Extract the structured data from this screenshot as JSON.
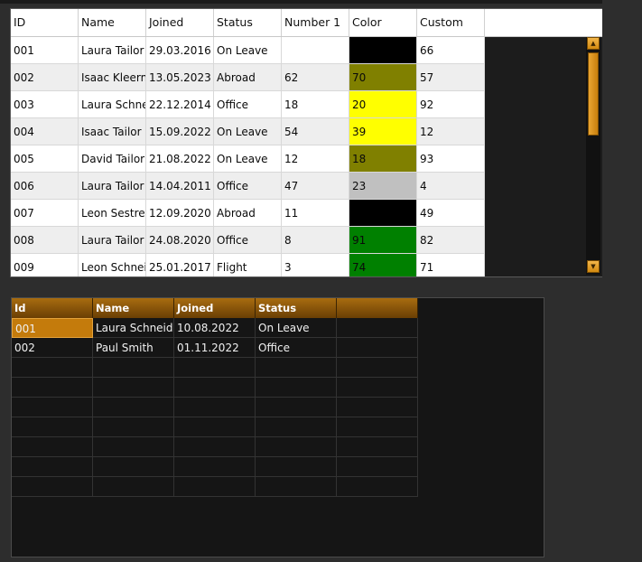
{
  "grid1": {
    "columns": [
      "ID",
      "Name",
      "Joined",
      "Status",
      "Number 1",
      "Color",
      "Custom"
    ],
    "rows": [
      {
        "id": "001",
        "name": "Laura Tailor",
        "joined": "29.03.2016",
        "status": "On Leave",
        "number1": "",
        "color_value": "",
        "color_hex": "#000000",
        "custom": "66"
      },
      {
        "id": "002",
        "name": "Isaac Kleerm",
        "joined": "13.05.2023",
        "status": "Abroad",
        "number1": "62",
        "color_value": "70",
        "color_hex": "#808000",
        "custom": "57"
      },
      {
        "id": "003",
        "name": "Laura Schnei",
        "joined": "22.12.2014",
        "status": "Office",
        "number1": "18",
        "color_value": "20",
        "color_hex": "#ffff00",
        "custom": "92"
      },
      {
        "id": "004",
        "name": "Isaac Tailor",
        "joined": "15.09.2022",
        "status": "On Leave",
        "number1": "54",
        "color_value": "39",
        "color_hex": "#ffff00",
        "custom": "12"
      },
      {
        "id": "005",
        "name": "David Tailor",
        "joined": "21.08.2022",
        "status": "On Leave",
        "number1": "12",
        "color_value": "18",
        "color_hex": "#808000",
        "custom": "93"
      },
      {
        "id": "006",
        "name": "Laura Tailor",
        "joined": "14.04.2011",
        "status": "Office",
        "number1": "47",
        "color_value": "23",
        "color_hex": "#c0c0c0",
        "custom": "4"
      },
      {
        "id": "007",
        "name": "Leon Sestre",
        "joined": "12.09.2020",
        "status": "Abroad",
        "number1": "11",
        "color_value": "",
        "color_hex": "#000000",
        "custom": "49"
      },
      {
        "id": "008",
        "name": "Laura Tailor",
        "joined": "24.08.2020",
        "status": "Office",
        "number1": "8",
        "color_value": "91",
        "color_hex": "#008000",
        "custom": "82"
      },
      {
        "id": "009",
        "name": "Leon Schnei",
        "joined": "25.01.2017",
        "status": "Flight",
        "number1": "3",
        "color_value": "74",
        "color_hex": "#008000",
        "custom": "71"
      }
    ]
  },
  "grid2": {
    "columns": [
      "Id",
      "Name",
      "Joined",
      "Status",
      ""
    ],
    "rows": [
      {
        "id": "001",
        "name": "Laura Schneider",
        "joined": "10.08.2022",
        "status": "On Leave",
        "extra": ""
      },
      {
        "id": "002",
        "name": "Paul Smith",
        "joined": "01.11.2022",
        "status": "Office",
        "extra": ""
      },
      {
        "id": "",
        "name": "",
        "joined": "",
        "status": "",
        "extra": ""
      },
      {
        "id": "",
        "name": "",
        "joined": "",
        "status": "",
        "extra": ""
      },
      {
        "id": "",
        "name": "",
        "joined": "",
        "status": "",
        "extra": ""
      },
      {
        "id": "",
        "name": "",
        "joined": "",
        "status": "",
        "extra": ""
      },
      {
        "id": "",
        "name": "",
        "joined": "",
        "status": "",
        "extra": ""
      },
      {
        "id": "",
        "name": "",
        "joined": "",
        "status": "",
        "extra": ""
      },
      {
        "id": "",
        "name": "",
        "joined": "",
        "status": "",
        "extra": ""
      }
    ]
  },
  "theme": {
    "accent": "#d38a10",
    "header_grad_top": "#a86c10",
    "selection": "#c47b0c"
  },
  "icons": {
    "scroll_up": "triangle-up",
    "scroll_down": "triangle-down"
  }
}
